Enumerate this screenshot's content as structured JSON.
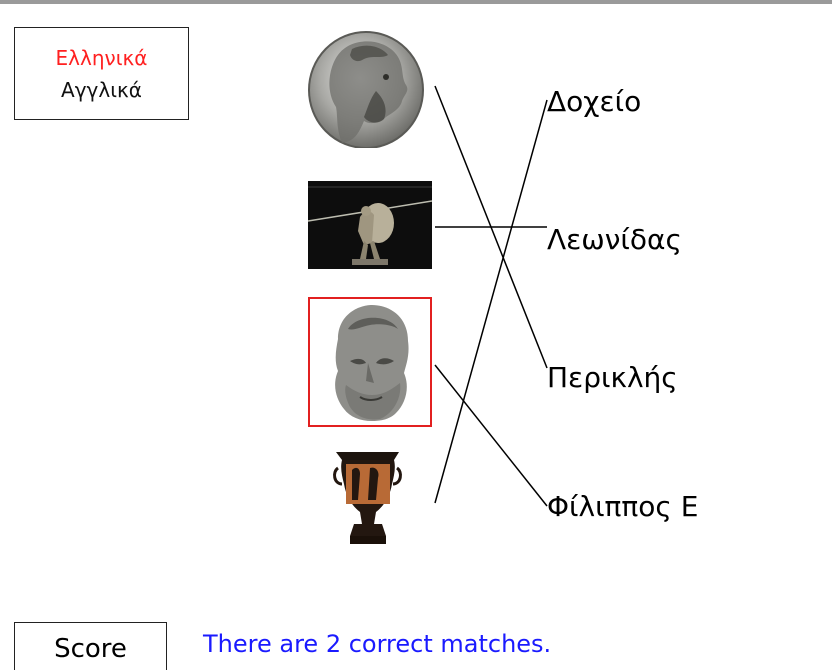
{
  "language": {
    "options": [
      "Ελληνικά",
      "Αγγλικά"
    ],
    "selected": "Ελληνικά"
  },
  "images": [
    {
      "id": "philip-coin",
      "subject": "coin-portrait"
    },
    {
      "id": "leonidas-statue",
      "subject": "warrior-statue"
    },
    {
      "id": "aristotle-bust",
      "subject": "marble-bust",
      "selected": true
    },
    {
      "id": "krater-vase",
      "subject": "red-figure-vase"
    }
  ],
  "names": [
    "Δοχείο",
    "Λεωνίδας",
    "Περικλής",
    "Φίλιππος Ε"
  ],
  "matches": [
    {
      "image": 0,
      "name": 2
    },
    {
      "image": 1,
      "name": 1
    },
    {
      "image": 2,
      "name": 3
    },
    {
      "image": 3,
      "name": 0
    }
  ],
  "score": {
    "button_label": "Score",
    "message": "There are 2 correct matches."
  },
  "colors": {
    "selected_language": "#ff2020",
    "selection_border": "#e22020",
    "score_message": "#1a1aff",
    "match_line": "#000000"
  }
}
